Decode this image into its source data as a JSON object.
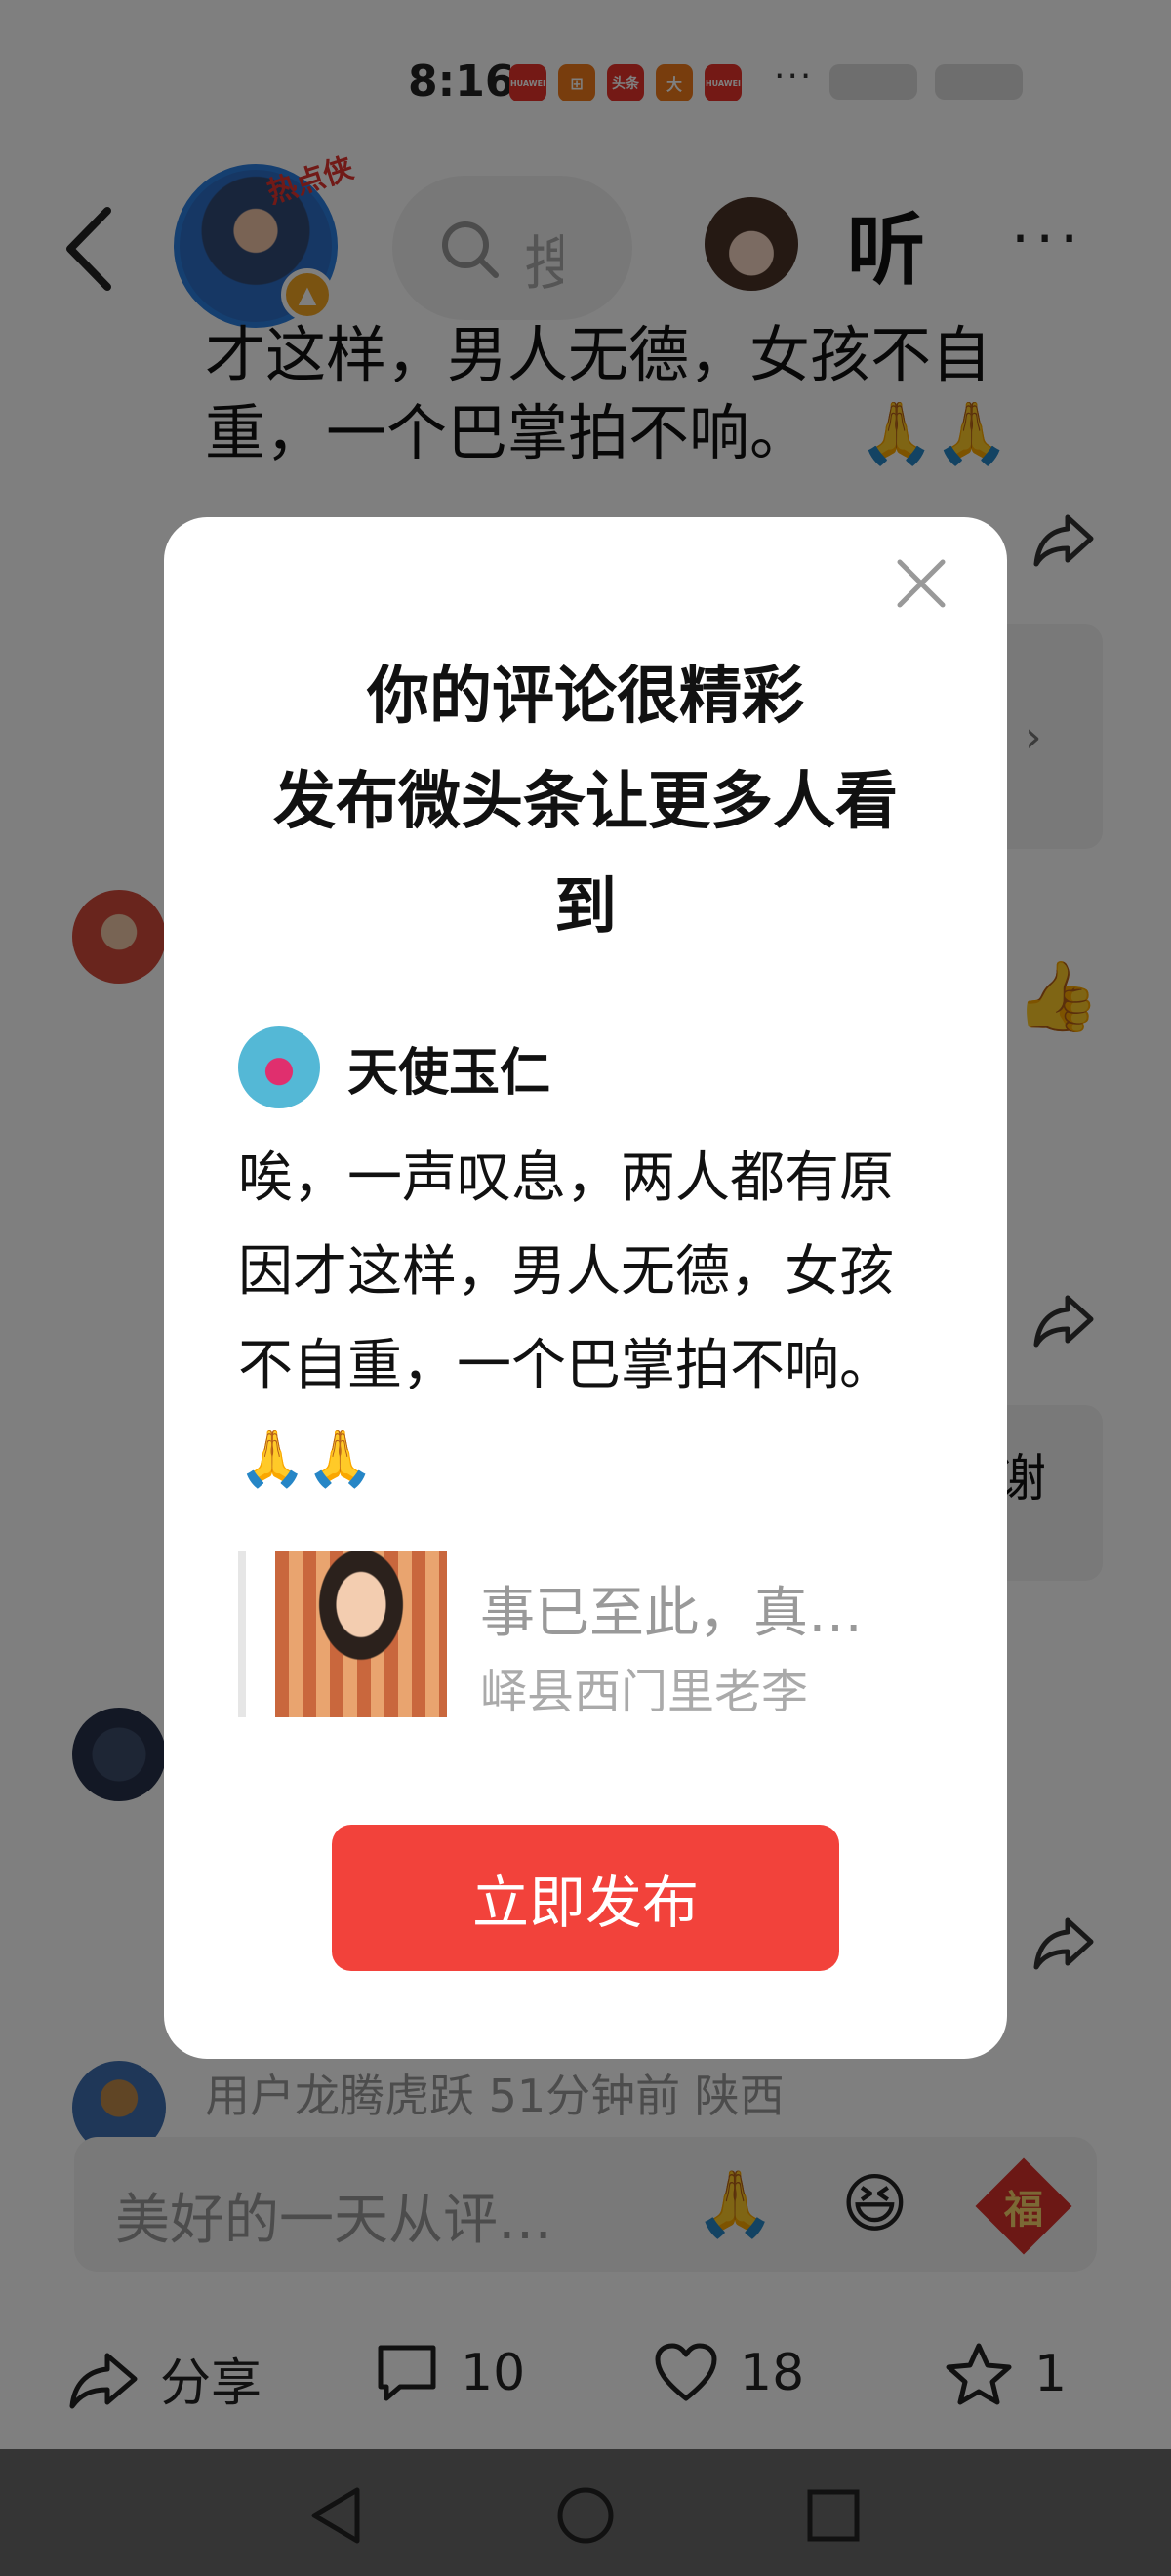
{
  "status_bar": {
    "time": "8:16",
    "apps": [
      "HUAWEI",
      "⊞",
      "头条",
      "大",
      "HUAWEI"
    ],
    "more": "···"
  },
  "top_nav": {
    "hot_badge": "热点侠",
    "search_placeholder": "搜",
    "listen_label": "听",
    "more_label": "···"
  },
  "background": {
    "partial_text_line1": "才这样，男人无德，女孩不自",
    "partial_text_line2": "重，一个巴掌拍不响。",
    "partial_right_text": "谢",
    "partial_comment_meta": "用户龙腾虎跃  51分钟前  陕西"
  },
  "bottom_input": {
    "placeholder": "美好的一天从评…",
    "emojis": [
      "🙏",
      "😆",
      "福"
    ]
  },
  "bottom_bar": {
    "share_label": "分享",
    "comment_count": "10",
    "like_count": "18",
    "favorite_count": "1"
  },
  "modal": {
    "title_line1": "你的评论很精彩",
    "title_line2": "发布微头条让更多人看",
    "title_line3": "到",
    "author_name": "天使玉仁",
    "comment_text": "唉，一声叹息，两人都有原因才这样，男人无德，女孩不自重，一个巴掌拍不响。🙏🙏",
    "quote_text": "事已至此，真…",
    "quote_source": "峄县西门里老李",
    "publish_button": "立即发布"
  }
}
